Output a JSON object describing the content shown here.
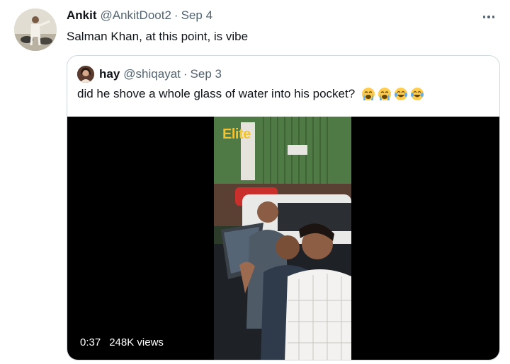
{
  "tweet": {
    "author_name": "Ankit",
    "author_handle": "@AnkitDoot2",
    "separator": "·",
    "date": "Sep 4",
    "text": "Salman Khan, at this point, is vibe"
  },
  "quoted_tweet": {
    "author_name": "hay",
    "author_handle": "@shiqayat",
    "separator": "·",
    "date": "Sep 3",
    "text": "did he shove a whole glass of water into his pocket?",
    "emojis": [
      "loudly-crying-face",
      "loudly-crying-face",
      "face-with-tears-of-joy",
      "face-with-tears-of-joy"
    ]
  },
  "media": {
    "watermark": "Elite",
    "duration": "0:37",
    "views": "248K views"
  },
  "icons": {
    "more": "more-horizontal-icon"
  },
  "colors": {
    "primary_text": "#0f1419",
    "secondary_text": "#536471",
    "border": "#cfd9de",
    "watermark": "#f2c230"
  }
}
